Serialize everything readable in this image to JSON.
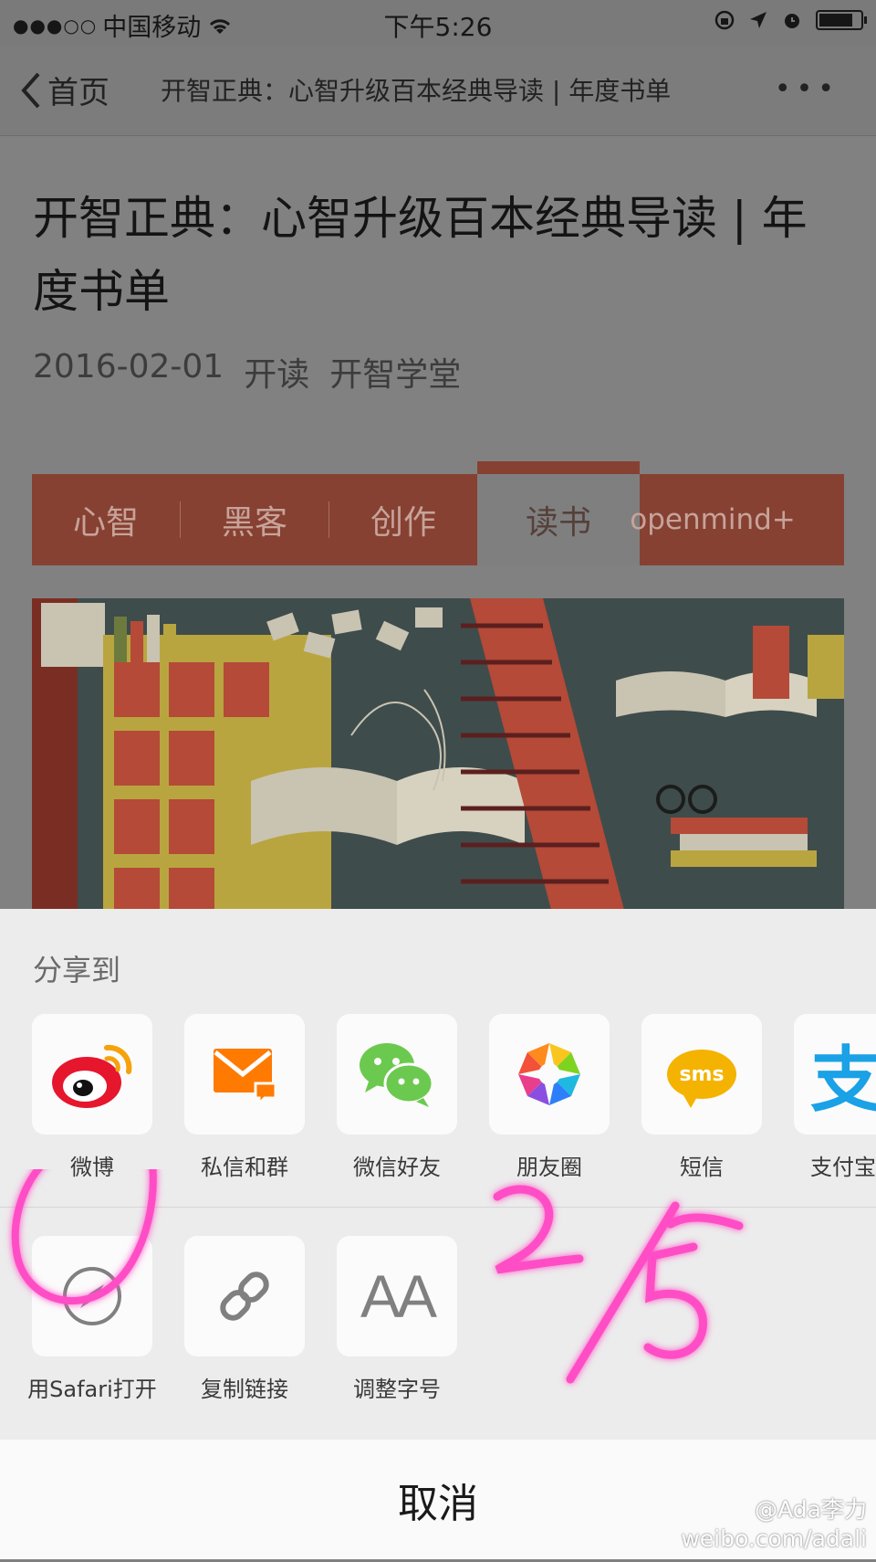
{
  "status_bar": {
    "signal": "●●●○○",
    "carrier": "中国移动",
    "time": "下午5:26"
  },
  "nav": {
    "back_label": "首页",
    "title": "开智正典：心智升级百本经典导读 | 年度书单",
    "more_label": "•••"
  },
  "article": {
    "title": "开智正典：心智升级百本经典导读 | 年度书单",
    "date": "2016-02-01",
    "tag": "开读",
    "author": "开智学堂",
    "tabs": [
      "心智",
      "黑客",
      "创作",
      "读书",
      "openmind+"
    ],
    "active_tab": "读书"
  },
  "share_sheet": {
    "header": "分享到",
    "share_targets": [
      {
        "label": "微博",
        "icon": "weibo-icon"
      },
      {
        "label": "私信和群",
        "icon": "envelope-icon"
      },
      {
        "label": "微信好友",
        "icon": "wechat-icon"
      },
      {
        "label": "朋友圈",
        "icon": "moments-aperture-icon"
      },
      {
        "label": "短信",
        "icon": "sms-bubble-icon",
        "badge": "sms"
      },
      {
        "label": "支付宝好",
        "icon": "alipay-icon",
        "glyph": "支"
      }
    ],
    "actions": [
      {
        "label": "用Safari打开",
        "icon": "compass-icon"
      },
      {
        "label": "复制链接",
        "icon": "link-icon"
      },
      {
        "label": "调整字号",
        "icon": "font-size-icon",
        "glyph": "AA"
      }
    ],
    "cancel_label": "取消"
  },
  "annotation": {
    "handwritten_text": "2/5"
  },
  "watermark": {
    "handle": "@Ada李力",
    "url": "weibo.com/adali"
  },
  "colors": {
    "tab_bar": "#864132",
    "weibo_red": "#e6162d",
    "envelope_orange": "#ff7a00",
    "wechat_green": "#6cc94f",
    "sms_yellow": "#f4b300",
    "alipay_blue": "#1aa1e6",
    "annotation_pink": "#ff3fbf"
  }
}
